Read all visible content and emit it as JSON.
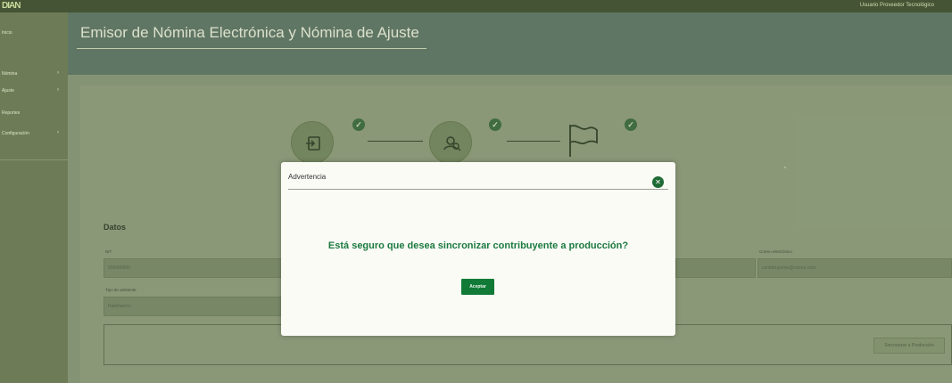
{
  "app": {
    "logo": "DIAN",
    "user_name": "Usuario Proveedor Tecnológico",
    "page_title": "Emisor de Nómina Electrónica y Nómina de Ajuste"
  },
  "sidebar": {
    "items": [
      {
        "label": "Inicio"
      },
      {
        "label": "Nómina"
      },
      {
        "label": "Ajuste"
      },
      {
        "label": "Reportes"
      },
      {
        "label": "Configuración"
      }
    ]
  },
  "steps": [
    {
      "icon": "login-icon",
      "status": "check"
    },
    {
      "icon": "user-search-icon",
      "status": "check"
    },
    {
      "icon": "flag-icon",
      "status": "check"
    }
  ],
  "form": {
    "section_title": "Datos",
    "fields": [
      {
        "label": "NIT",
        "value": "900000000"
      },
      {
        "label": "Tipo de ambiente",
        "value": "Habilitación"
      },
      {
        "label": "Correo electrónico",
        "value": "contribuyente@correo.com"
      }
    ],
    "sync_button": "Sincronizar a Producción"
  },
  "modal": {
    "title": "Advertencia",
    "close_icon": "close-icon",
    "message": "Está seguro que desea sincronizar contribuyente a producción?",
    "accept_label": "Aceptar"
  },
  "colors": {
    "accent_green": "#117a37",
    "message_green": "#1a7a3f",
    "overlay": "#7f8c6a"
  }
}
